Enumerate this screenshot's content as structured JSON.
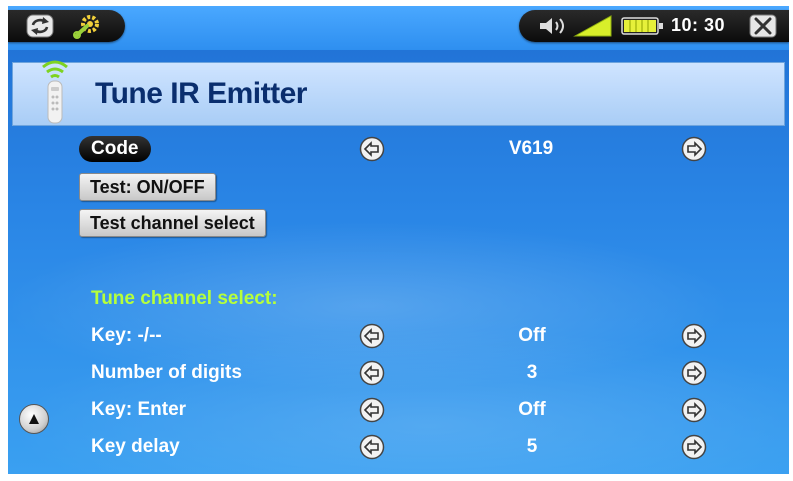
{
  "status": {
    "time": "10: 30"
  },
  "header": {
    "title": "Tune IR Emitter"
  },
  "top": {
    "code_label": "Code",
    "code_value": "V619",
    "test_onoff_label": "Test: ON/OFF",
    "test_channel_label": "Test channel select"
  },
  "section_title": "Tune channel select:",
  "settings": [
    {
      "label": "Key: -/--",
      "value": "Off"
    },
    {
      "label": "Number of digits",
      "value": "3"
    },
    {
      "label": "Key: Enter",
      "value": "Off"
    },
    {
      "label": "Key delay",
      "value": "5"
    }
  ],
  "battery_level": 1.0,
  "icons": [
    "sync-icon",
    "settings-wrench-icon",
    "volume-icon",
    "signal-strength-icon",
    "battery-icon",
    "close-icon",
    "remote-control-icon",
    "arrow-left-icon",
    "arrow-right-icon",
    "scroll-up-icon"
  ]
}
